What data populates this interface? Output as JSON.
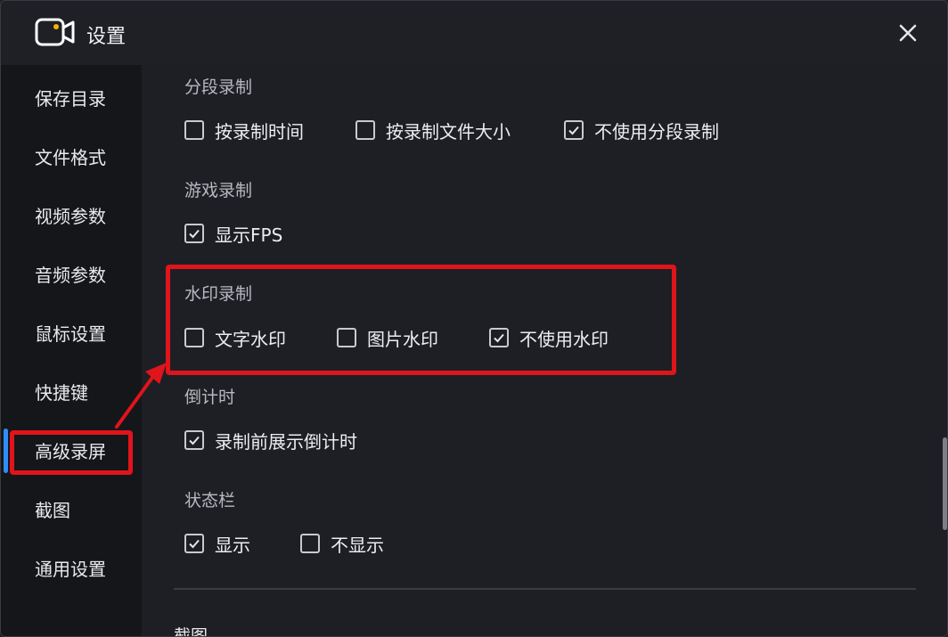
{
  "window": {
    "title": "设置"
  },
  "sidebar": {
    "items": [
      {
        "label": "保存目录"
      },
      {
        "label": "文件格式"
      },
      {
        "label": "视频参数"
      },
      {
        "label": "音频参数"
      },
      {
        "label": "鼠标设置"
      },
      {
        "label": "快捷键"
      },
      {
        "label": "高级录屏",
        "active": true
      },
      {
        "label": "截图"
      },
      {
        "label": "通用设置"
      }
    ]
  },
  "sections": [
    {
      "title": "分段录制",
      "options": [
        {
          "label": "按录制时间",
          "checked": false
        },
        {
          "label": "按录制文件大小",
          "checked": false
        },
        {
          "label": "不使用分段录制",
          "checked": true
        }
      ]
    },
    {
      "title": "游戏录制",
      "options": [
        {
          "label": "显示FPS",
          "checked": true
        }
      ]
    },
    {
      "title": "水印录制",
      "options": [
        {
          "label": "文字水印",
          "checked": false
        },
        {
          "label": "图片水印",
          "checked": false
        },
        {
          "label": "不使用水印",
          "checked": true
        }
      ]
    },
    {
      "title": "倒计时",
      "options": [
        {
          "label": "录制前展示倒计时",
          "checked": true
        }
      ]
    },
    {
      "title": "状态栏",
      "options": [
        {
          "label": "显示",
          "checked": true
        },
        {
          "label": "不显示",
          "checked": false
        }
      ]
    }
  ],
  "next_section_title": "截图",
  "colors": {
    "accent": "#2f8cff",
    "highlight": "#e0141b",
    "logo_dot": "#f5b400"
  },
  "icons": {
    "logo": "video-camera-icon",
    "close": "close-icon",
    "check": "checkmark-icon"
  }
}
